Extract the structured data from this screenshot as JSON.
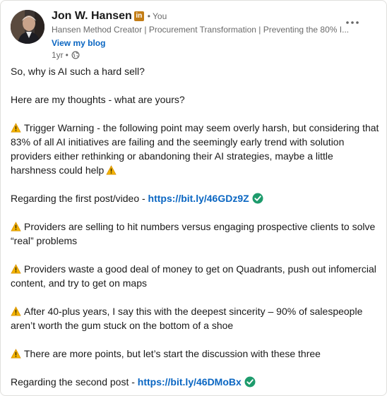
{
  "author": {
    "name": "Jon W. Hansen",
    "badge": "in",
    "separator": "•",
    "relation": "You",
    "headline": "Hansen Method Creator | Procurement Transformation | Preventing the 80% I...",
    "blog_link": "View my blog",
    "time": "1yr",
    "time_separator": "•",
    "visibility_icon": "globe-icon"
  },
  "menu_icon": "more-horizontal-icon",
  "post": {
    "p1": "So, why is AI such a hard sell?",
    "p2": "Here are my thoughts - what are yours?",
    "p3": "Trigger Warning - the following point may seem overly harsh, but considering that 83% of all AI initiatives are failing and the seemingly early trend with solution providers either rethinking or abandoning their AI strategies, maybe a little harshness could help",
    "p4_prefix": "Regarding the first post/video - ",
    "p4_link": "https://bit.ly/46GDz9Z",
    "p5": "Providers are selling to hit numbers versus engaging prospective clients to solve “real” problems",
    "p6": "Providers waste a good deal of money to get on Quadrants, push out infomercial content, and try to get on maps",
    "p7": "After 40-plus years, I say this with the deepest sincerity – 90% of salespeople aren’t worth the gum stuck on the bottom of a shoe",
    "p8": "There are more points, but let’s start the discussion with these three",
    "p9_prefix": "Regarding the second post - ",
    "p9_link": "https://bit.ly/46DMoBx",
    "warning_icon": "warning-icon",
    "check_icon": "check-mark-icon"
  },
  "colors": {
    "link": "#0a66c2",
    "badge": "#c37d16",
    "check": "#1d9b6c",
    "warning": "#f4b400"
  }
}
